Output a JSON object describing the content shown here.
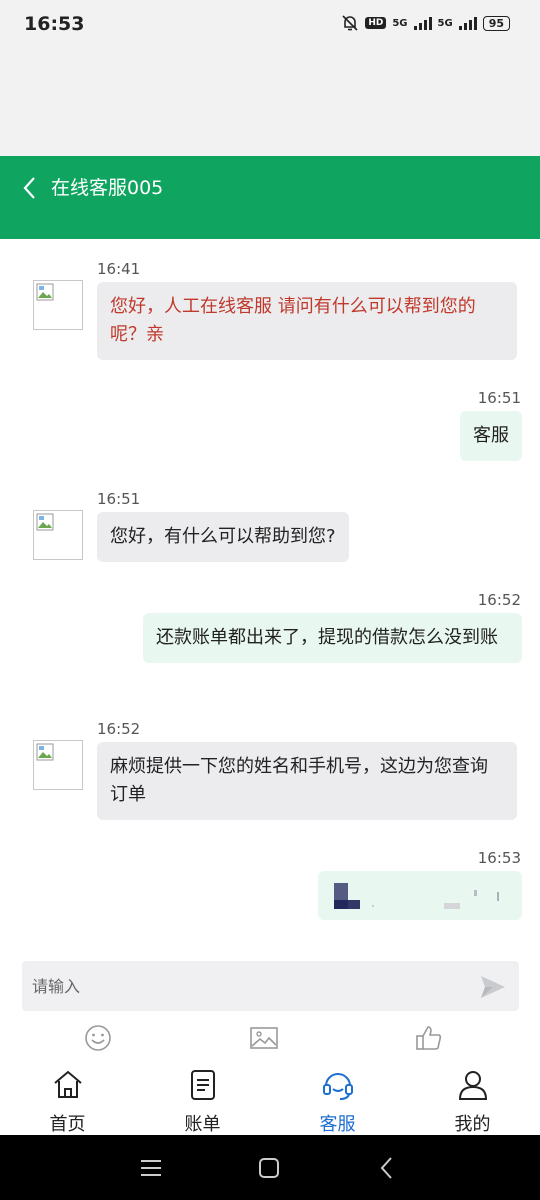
{
  "status_bar": {
    "time": "16:53",
    "hd": "HD",
    "net1": "5G",
    "net2": "5G",
    "battery": "95"
  },
  "header": {
    "title": "在线客服005"
  },
  "messages": [
    {
      "side": "in",
      "time": "16:41",
      "text": "您好，人工在线客服 请问有什么可以帮到您的呢？亲",
      "color": "#c0392b"
    },
    {
      "side": "out",
      "time": "16:51",
      "text": "客服"
    },
    {
      "side": "in",
      "time": "16:51",
      "text": "您好，有什么可以帮助到您?"
    },
    {
      "side": "out",
      "time": "16:52",
      "text": "还款账单都出来了，提现的借款怎么没到账"
    },
    {
      "side": "in",
      "time": "16:52",
      "text": "麻烦提供一下您的姓名和手机号，这边为您查询订单"
    },
    {
      "side": "out",
      "time": "16:53",
      "text": ""
    }
  ],
  "input": {
    "placeholder": "请输入",
    "value": ""
  },
  "toolbar": {
    "icons": [
      "emoji-icon",
      "image-icon",
      "thumbs-up-icon"
    ]
  },
  "tabs": [
    {
      "label": "首页",
      "icon": "home-icon",
      "active": false
    },
    {
      "label": "账单",
      "icon": "bill-icon",
      "active": false
    },
    {
      "label": "客服",
      "icon": "headset-icon",
      "active": true
    },
    {
      "label": "我的",
      "icon": "user-icon",
      "active": false
    }
  ],
  "colors": {
    "header_bg": "#10a461",
    "active_tab": "#1f6fd1",
    "agent_first_msg": "#c0392b"
  }
}
